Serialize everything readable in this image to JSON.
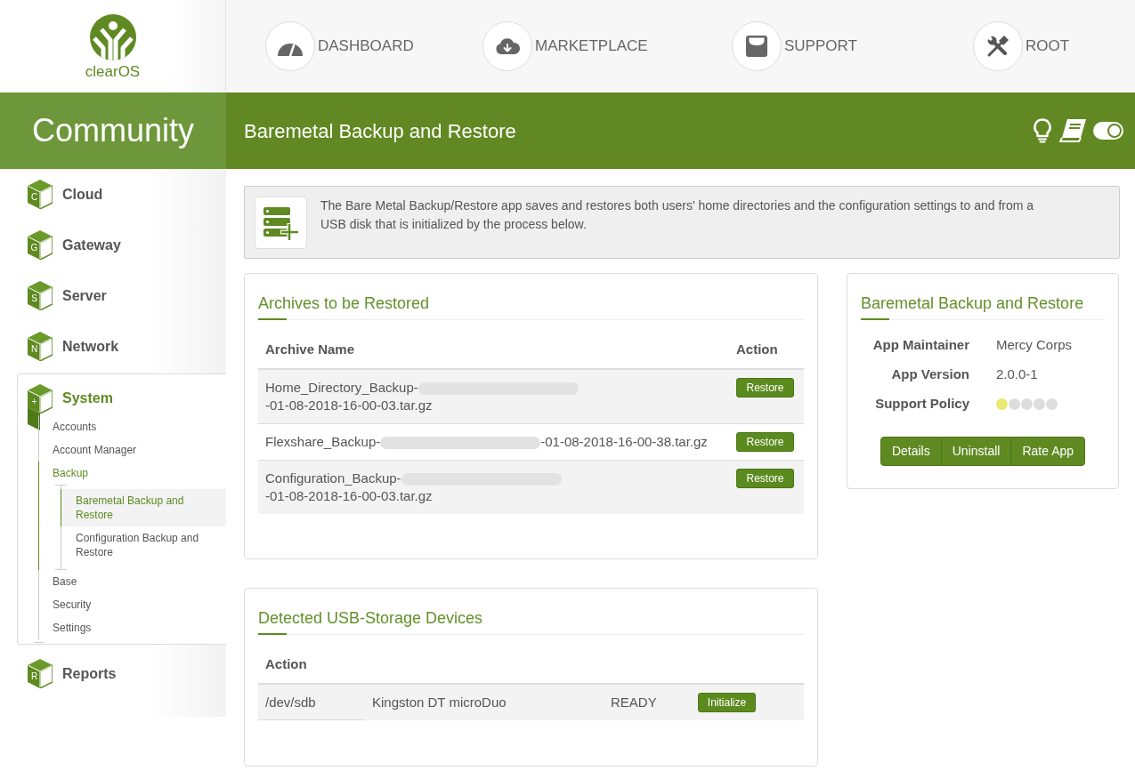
{
  "logo": {
    "text": "clearOS"
  },
  "nav": [
    {
      "label": "DASHBOARD"
    },
    {
      "label": "MARKETPLACE"
    },
    {
      "label": "SUPPORT"
    },
    {
      "label": "ROOT"
    }
  ],
  "banner": {
    "edition": "Community",
    "title": "Baremetal Backup and Restore",
    "toggle": {
      "on": true
    }
  },
  "sidebar": {
    "categories": [
      {
        "letter": "C",
        "label": "Cloud",
        "expanded": false
      },
      {
        "letter": "G",
        "label": "Gateway",
        "expanded": false
      },
      {
        "letter": "S",
        "label": "Server",
        "expanded": false
      },
      {
        "letter": "N",
        "label": "Network",
        "expanded": false
      },
      {
        "letter": "+",
        "label": "System",
        "expanded": true,
        "children": [
          {
            "label": "Accounts",
            "expanded": false
          },
          {
            "label": "Account Manager",
            "expanded": false
          },
          {
            "label": "Backup",
            "expanded": true,
            "children": [
              {
                "label": "Baremetal Backup and Restore",
                "selected": true
              },
              {
                "label": "Configuration Backup and Restore",
                "selected": false
              }
            ]
          },
          {
            "label": "Base",
            "expanded": false
          },
          {
            "label": "Security",
            "expanded": false
          },
          {
            "label": "Settings",
            "expanded": false
          }
        ]
      },
      {
        "letter": "R",
        "label": "Reports",
        "expanded": false
      }
    ]
  },
  "intro": {
    "text": "The Bare Metal Backup/Restore app saves and restores both users' home directories and the configuration settings to and from a USB disk that is initialized by the process below."
  },
  "archives": {
    "title": "Archives to be Restored",
    "columns": [
      "Archive Name",
      "Action"
    ],
    "rows": [
      {
        "name_prefix": "Home_Directory_Backup-",
        "redacted": true,
        "name_suffix": "-01-08-2018-16-00-03.tar.gz",
        "action": "Restore"
      },
      {
        "name_prefix": "Flexshare_Backup-",
        "redacted": true,
        "name_suffix": "-01-08-2018-16-00-38.tar.gz",
        "action": "Restore"
      },
      {
        "name_prefix": "Configuration_Backup-",
        "redacted": true,
        "name_suffix": "-01-08-2018-16-00-03.tar.gz",
        "action": "Restore"
      }
    ]
  },
  "usb": {
    "title": "Detected USB-Storage Devices",
    "columns": [
      "Action"
    ],
    "rows": [
      {
        "cells": [
          "/dev/sdb",
          "Kingston DT microDuo",
          "READY"
        ],
        "action": "Initialize"
      }
    ]
  },
  "app_info": {
    "title": "Baremetal Backup and Restore",
    "fields": [
      {
        "kind": "text",
        "label": "App Maintainer",
        "value": "Mercy Corps"
      },
      {
        "kind": "text",
        "label": "App Version",
        "value": "2.0.0-1"
      },
      {
        "kind": "rating",
        "label": "Support Policy",
        "stars": 1
      }
    ],
    "buttons": [
      "Details",
      "Uninstall",
      "Rate App"
    ]
  }
}
